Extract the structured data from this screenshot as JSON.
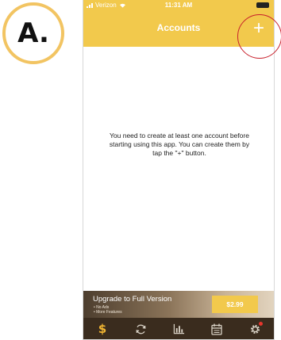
{
  "step_badge": {
    "label": "A."
  },
  "status_bar": {
    "carrier": "Verizon",
    "time": "11:31 AM"
  },
  "nav": {
    "title": "Accounts",
    "add_label": "+"
  },
  "empty_state": {
    "message": "You need to create at least one account before starting using this app. You can create them by tap the \"+\" button."
  },
  "upgrade": {
    "title": "Upgrade to Full Version",
    "features": [
      "• No Ads",
      "• More Features"
    ],
    "price": "$2.99"
  },
  "tabs": [
    {
      "icon": "dollar-icon",
      "label": "$",
      "active": true
    },
    {
      "icon": "sync-icon"
    },
    {
      "icon": "bar-chart-icon"
    },
    {
      "icon": "calendar-icon"
    },
    {
      "icon": "gear-icon",
      "notification": true
    }
  ],
  "colors": {
    "accent": "#F2C94C",
    "tabbar": "#3a2c1e",
    "tab_icon": "#d9d2c6",
    "active_tab": "#F2B632",
    "badge_ring": "#F2C462",
    "annotation": "#c8202b"
  }
}
